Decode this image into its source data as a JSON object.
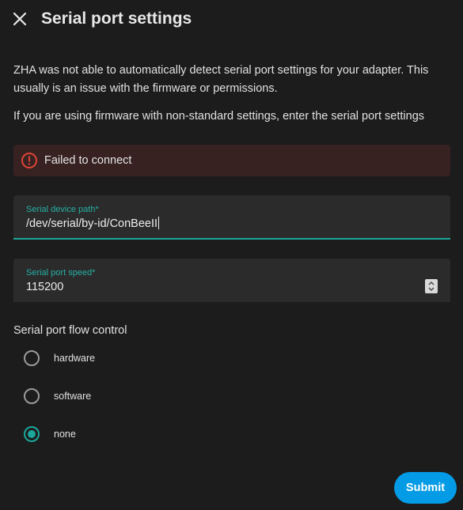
{
  "dialog": {
    "title": "Serial port settings",
    "description": "ZHA was not able to automatically detect serial port settings for your adapter. This usually is an issue with the firmware or permissions.",
    "instruction": "If you are using firmware with non-standard settings, enter the serial port settings"
  },
  "alert": {
    "text": "Failed to connect",
    "icon": "alert-circle-icon",
    "color": "#db4437"
  },
  "fields": {
    "path": {
      "label": "Serial device path*",
      "value": "/dev/serial/by-id/ConBeeII"
    },
    "speed": {
      "label": "Serial port speed*",
      "value": "115200"
    }
  },
  "flow_control": {
    "label": "Serial port flow control",
    "options": [
      {
        "label": "hardware",
        "checked": false
      },
      {
        "label": "software",
        "checked": false
      },
      {
        "label": "none",
        "checked": true
      }
    ]
  },
  "actions": {
    "submit_label": "Submit"
  },
  "colors": {
    "accent": "#1ba79b",
    "primary_button": "#039be5",
    "background": "#1c1c1c",
    "error_background": "#372221"
  }
}
